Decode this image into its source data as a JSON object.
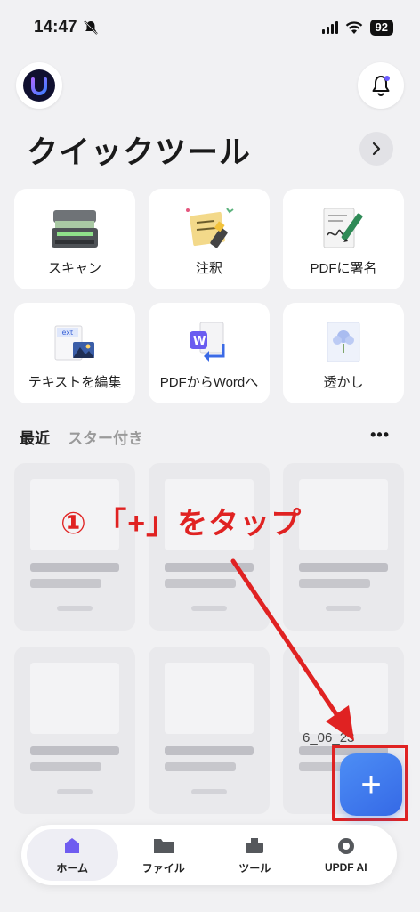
{
  "status_bar": {
    "time": "14:47",
    "battery": "92"
  },
  "header": {
    "title": "クイックツール"
  },
  "tools": [
    {
      "label": "スキャン",
      "icon": "scanner-icon"
    },
    {
      "label": "注釈",
      "icon": "sticky-note-icon"
    },
    {
      "label": "PDFに署名",
      "icon": "signature-pen-icon"
    },
    {
      "label": "テキストを編集",
      "icon": "edit-text-icon"
    },
    {
      "label": "PDFからWordへ",
      "icon": "pdf-to-word-icon"
    },
    {
      "label": "透かし",
      "icon": "watermark-icon"
    }
  ],
  "recent": {
    "tabs": [
      "最近",
      "スター付き"
    ],
    "date_fragment": "6_06_23"
  },
  "annotation": {
    "text": "① 「+」をタップ",
    "color": "#e02222"
  },
  "fab": {
    "label": "+"
  },
  "nav": [
    {
      "label": "ホーム",
      "icon": "home-icon"
    },
    {
      "label": "ファイル",
      "icon": "folder-icon"
    },
    {
      "label": "ツール",
      "icon": "toolbox-icon"
    },
    {
      "label": "UPDF AI",
      "icon": "ai-icon"
    }
  ],
  "colors": {
    "accent": "#3569e6",
    "highlight": "#e02222"
  }
}
